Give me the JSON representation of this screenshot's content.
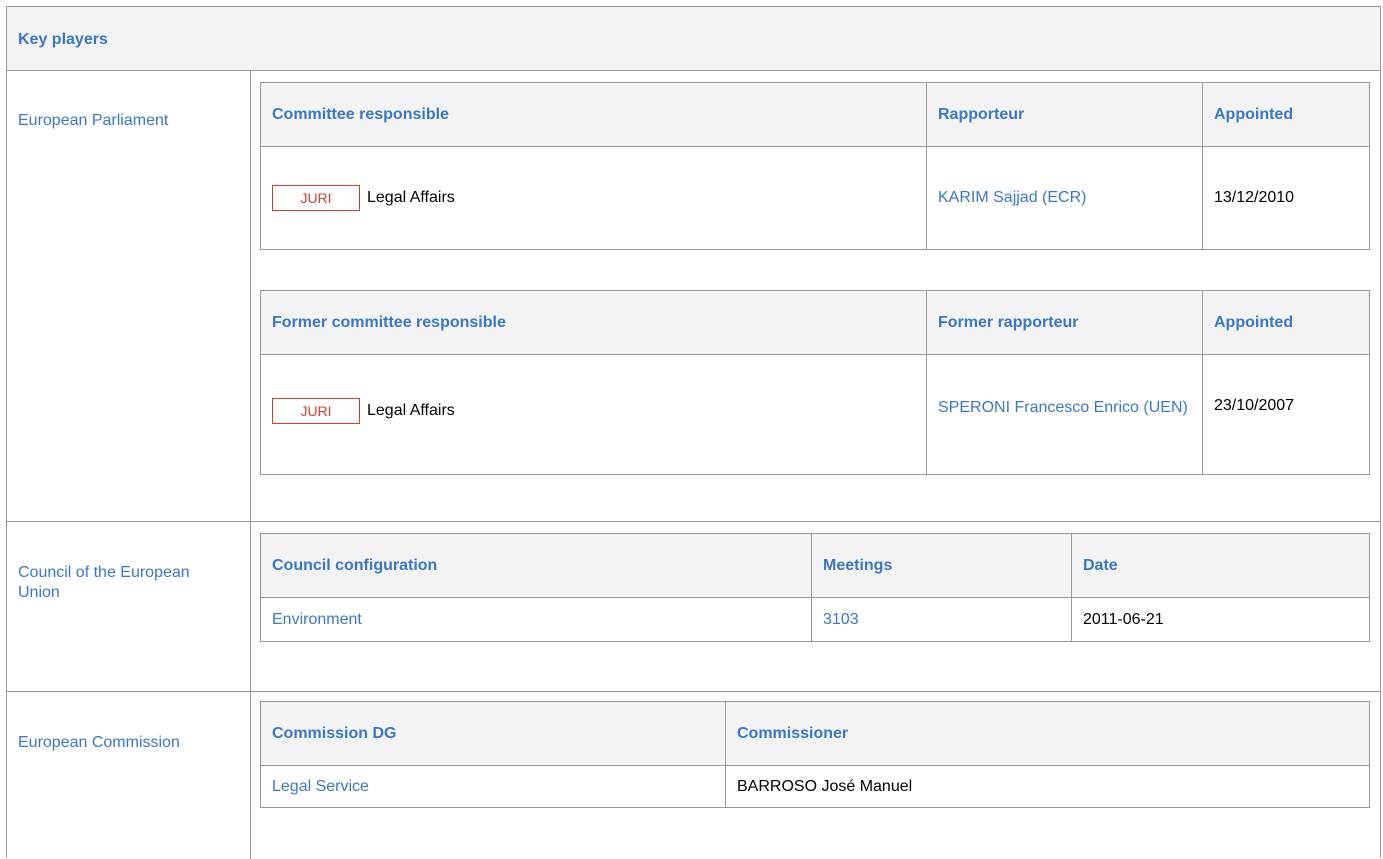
{
  "header": {
    "title": "Key players"
  },
  "sections": {
    "parliament": {
      "label": "European Parliament",
      "current": {
        "headers": [
          "Committee responsible",
          "Rapporteur",
          "Appointed"
        ],
        "row": {
          "badge": "JURI",
          "committee": "Legal Affairs",
          "rapporteur": "KARIM Sajjad (ECR)",
          "appointed": "13/12/2010"
        }
      },
      "former": {
        "headers": [
          "Former committee responsible",
          "Former rapporteur",
          "Appointed"
        ],
        "row": {
          "badge": "JURI",
          "committee": "Legal Affairs",
          "rapporteur": "SPERONI Francesco Enrico (UEN)",
          "appointed": "23/10/2007"
        }
      }
    },
    "council": {
      "label": "Council of the European Union",
      "headers": [
        "Council configuration",
        "Meetings",
        "Date"
      ],
      "row": {
        "configuration": "Environment",
        "meetings": "3103",
        "date": "2011-06-21"
      }
    },
    "commission": {
      "label": "European Commission",
      "headers": [
        "Commission DG",
        "Commissioner"
      ],
      "row": {
        "dg": "Legal Service",
        "commissioner": "BARROSO José Manuel"
      }
    }
  },
  "colors": {
    "link": "#3b78c3",
    "badge": "#c9432d",
    "header_bg": "#f3f3f3",
    "border": "#999999"
  }
}
